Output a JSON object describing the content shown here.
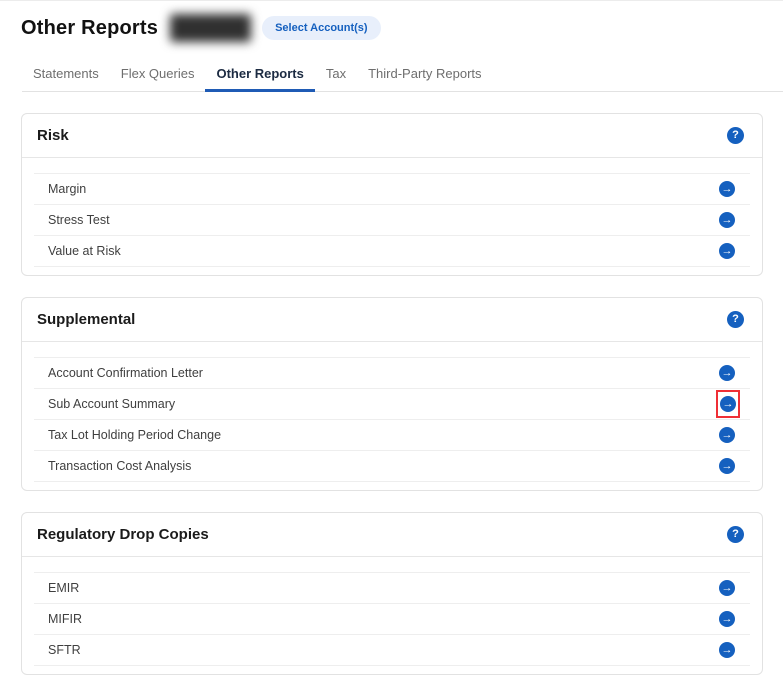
{
  "header": {
    "title": "Other Reports",
    "select_accounts_button": "Select Account(s)",
    "account_badge": {
      "redacted": true
    }
  },
  "tabs": {
    "items": [
      {
        "label": "Statements",
        "active": false
      },
      {
        "label": "Flex Queries",
        "active": false
      },
      {
        "label": "Other Reports",
        "active": true
      },
      {
        "label": "Tax",
        "active": false
      },
      {
        "label": "Third-Party Reports",
        "active": false
      }
    ]
  },
  "sections": [
    {
      "title": "Risk",
      "help_icon": "question-mark-circle-icon",
      "items": [
        "Margin",
        "Stress Test",
        "Value at Risk"
      ]
    },
    {
      "title": "Supplemental",
      "help_icon": "question-mark-circle-icon",
      "items": [
        "Account Confirmation Letter",
        "Sub Account Summary",
        "Tax Lot Holding Period Change",
        "Transaction Cost Analysis"
      ],
      "highlighted_item": "Sub Account Summary"
    },
    {
      "title": "Regulatory Drop Copies",
      "help_icon": "question-mark-circle-icon",
      "items": [
        "EMIR",
        "MIFIR",
        "SFTR"
      ]
    }
  ],
  "icons": {
    "help_glyph": "?",
    "arrow_glyph": "→"
  },
  "colors": {
    "accent_blue": "#1560bf",
    "active_tab_underline": "#1f5bb5",
    "select_button_bg": "#e8effb",
    "highlight_red": "#ef2f36"
  }
}
